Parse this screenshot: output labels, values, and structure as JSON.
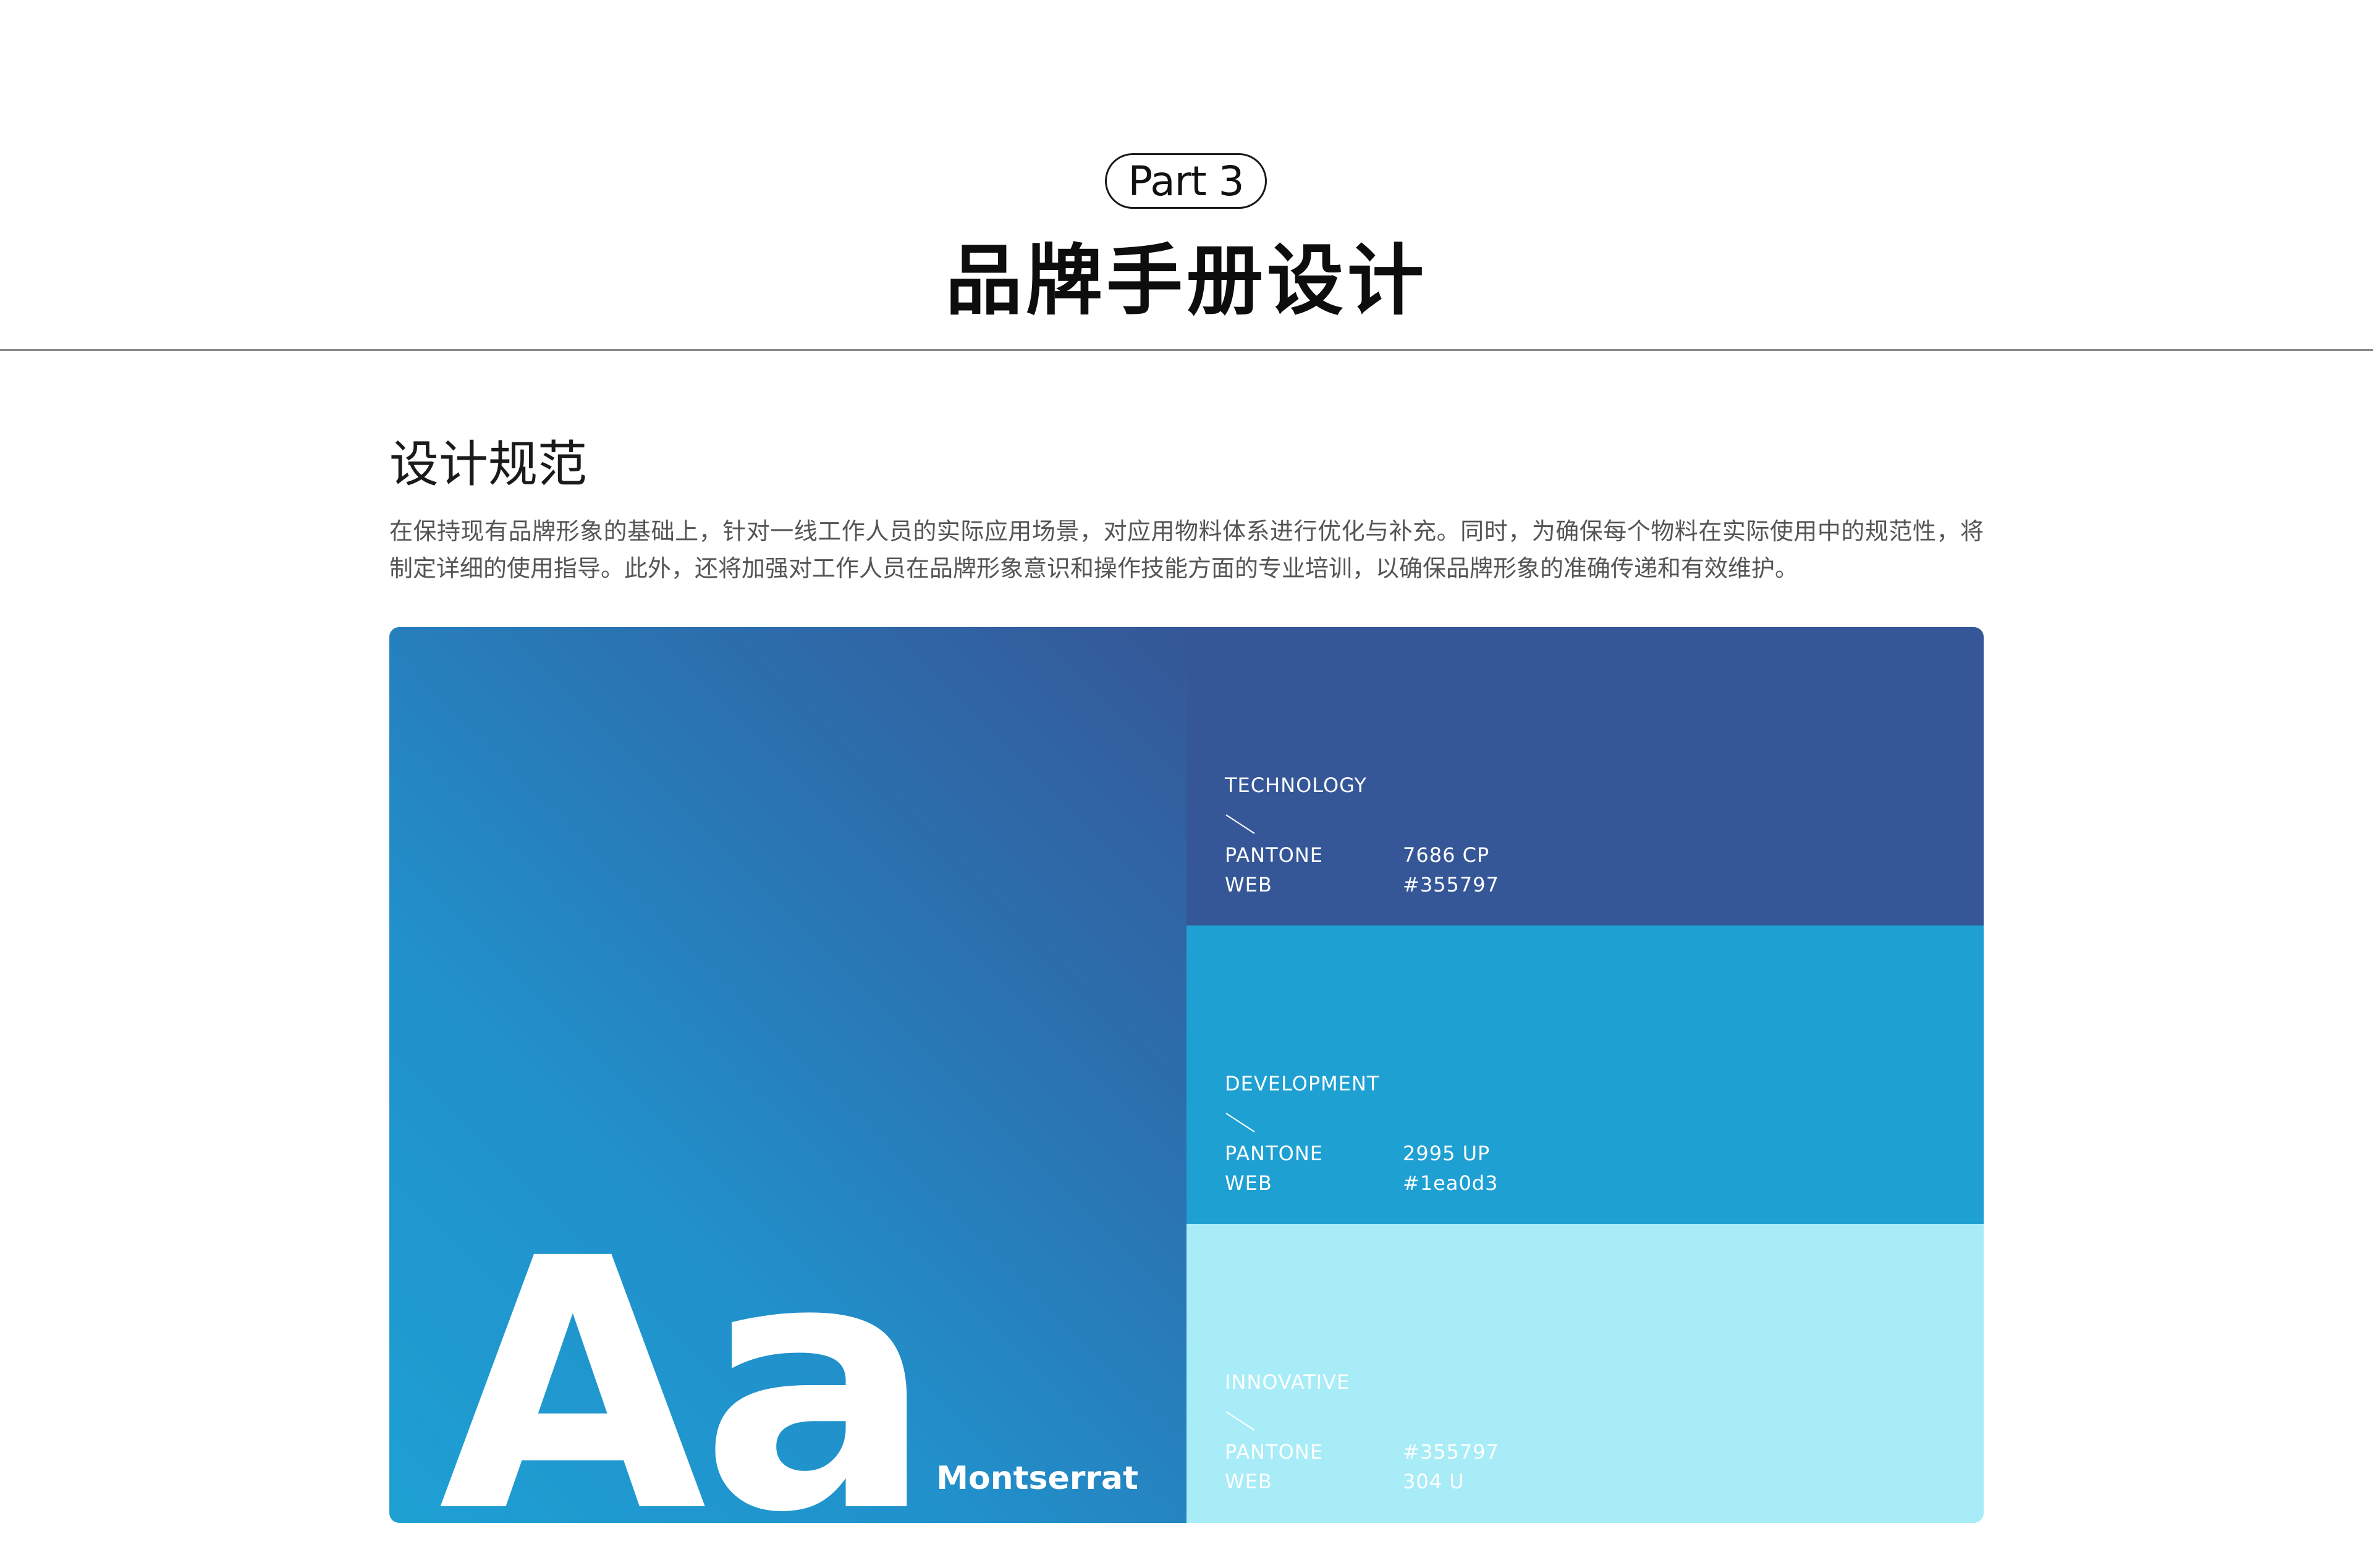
{
  "header": {
    "part_label": "Part 3",
    "title": "品牌手册设计"
  },
  "section": {
    "title": "设计规范",
    "description": "在保持现有品牌形象的基础上，针对一线工作人员的实际应用场景，对应用物料体系进行优化与补充。同时，为确保每个物料在实际使用中的规范性，将制定详细的使用指导。此外，还将加强对工作人员在品牌形象意识和操作技能方面的专业培训，以确保品牌形象的准确传递和有效维护。"
  },
  "typography": {
    "sample": "Aa",
    "font_name": "Montserrat"
  },
  "colors": [
    {
      "name": "TECHNOLOGY",
      "pantone_label": "PANTONE",
      "pantone_value": "7686 CP",
      "web_label": "WEB",
      "web_value": "#355797",
      "bg": "#355797",
      "text_color": "#ffffff"
    },
    {
      "name": "DEVELOPMENT",
      "pantone_label": "PANTONE",
      "pantone_value": "2995 UP",
      "web_label": "WEB",
      "web_value": "#1ea0d3",
      "bg": "#1ea0d3",
      "text_color": "#ffffff"
    },
    {
      "name": "INNOVATIVE",
      "pantone_label": "PANTONE",
      "pantone_value": "#355797",
      "web_label": "WEB",
      "web_value": "304 U",
      "bg": "#a8ecf7",
      "text_color": "#ffffff"
    }
  ]
}
